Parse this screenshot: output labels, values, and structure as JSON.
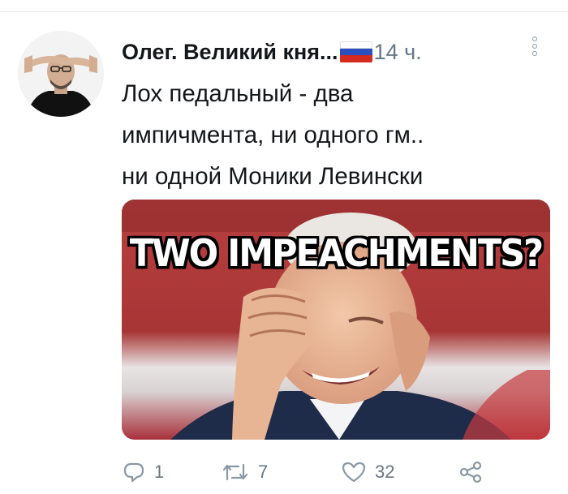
{
  "tweet": {
    "author_name": "Олег. Великий кня...",
    "timestamp": "14 ч.",
    "text": "Лох педальный - два\nимпичмента, ни одного гм..\nни одной Моники Левински",
    "media": {
      "caption": "TWO IMPEACHMENTS?"
    }
  },
  "actions": {
    "reply_count": "1",
    "retweet_count": "7",
    "like_count": "32"
  },
  "icons": {
    "more": "more-vertical-icon",
    "reply": "reply-icon",
    "retweet": "retweet-icon",
    "like": "heart-icon",
    "share": "share-icon"
  },
  "colors": {
    "text": "#14171a",
    "muted": "#657786",
    "icon": "#8899a6"
  }
}
